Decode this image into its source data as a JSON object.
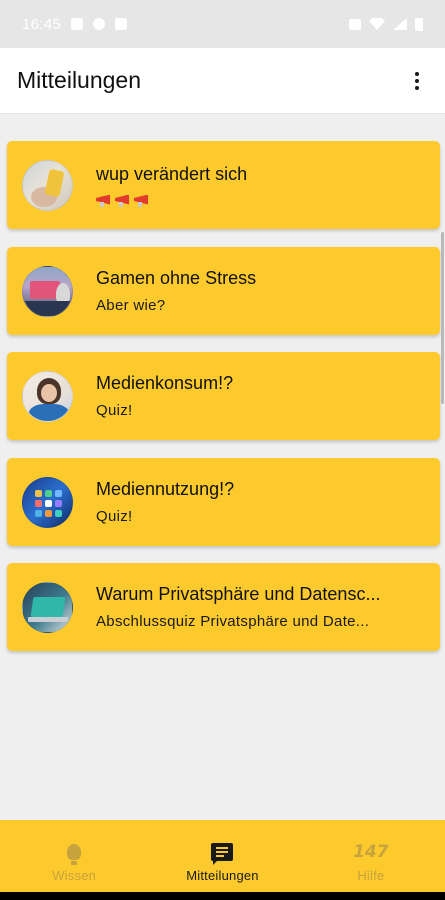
{
  "status_bar": {
    "time": "16:45",
    "left_icons": [
      "image-icon",
      "messenger-icon",
      "cast-icon"
    ],
    "right_icons": [
      "mute-icon",
      "wifi-icon",
      "signal-icon",
      "battery-icon"
    ]
  },
  "app_bar": {
    "title": "Mitteilungen",
    "menu_icon": "more-vert-icon"
  },
  "messages": [
    {
      "title": "wup verändert sich",
      "subtitle": "",
      "subtitle_emoji": "📢📢📢",
      "avatar": "hand-with-phone"
    },
    {
      "title": "Gamen ohne Stress",
      "subtitle": "Aber wie?",
      "avatar": "gaming-desk"
    },
    {
      "title": "Medienkonsum!?",
      "subtitle": "Quiz!",
      "avatar": "person-portrait"
    },
    {
      "title": "Mediennutzung!?",
      "subtitle": "Quiz!",
      "avatar": "phone-apps"
    },
    {
      "title": "Warum Privatsphäre und Datensc...",
      "subtitle": "Abschlussquiz Privatsphäre und Date...",
      "avatar": "laptop"
    }
  ],
  "bottom_nav": {
    "items": [
      {
        "label": "Wissen",
        "icon": "lightbulb-icon",
        "active": false
      },
      {
        "label": "Mitteilungen",
        "icon": "chat-icon",
        "active": true
      },
      {
        "label": "Hilfe",
        "icon": "147-icon",
        "icon_text": "147",
        "active": false
      }
    ]
  },
  "colors": {
    "accent": "#fdca2e",
    "background": "#efefef",
    "inactive_nav": "#c7a33d",
    "active_nav": "#1a1a1a",
    "megaphone": "#e23b2d"
  }
}
